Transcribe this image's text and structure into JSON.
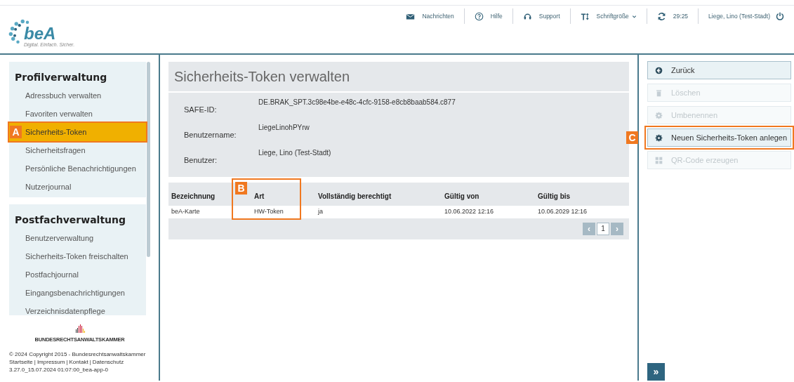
{
  "header": {
    "logo": {
      "name": "beA",
      "tagline": "Digital. Einfach. Sicher."
    },
    "nav": [
      {
        "kind": "mail",
        "label": "Nachrichten"
      },
      {
        "kind": "help",
        "label": "Hilfe"
      },
      {
        "kind": "support",
        "label": "Support"
      },
      {
        "kind": "font",
        "label": "Schriftgröße",
        "dropdown": true
      },
      {
        "kind": "refresh",
        "label": "29:25"
      },
      {
        "kind": "user",
        "label": "Liege, Lino (Test-Stadt)"
      }
    ]
  },
  "sidebar": {
    "sections": [
      {
        "title": "Profilverwaltung",
        "items": [
          {
            "label": "Adressbuch verwalten",
            "selected": false
          },
          {
            "label": "Favoriten verwalten",
            "selected": false
          },
          {
            "label": "Sicherheits-Token",
            "selected": true,
            "callout": "A"
          },
          {
            "label": "Sicherheitsfragen",
            "selected": false
          },
          {
            "label": "Persönliche Benachrichtigungen",
            "selected": false
          },
          {
            "label": "Nutzerjournal",
            "selected": false
          }
        ]
      },
      {
        "title": "Postfachverwaltung",
        "items": [
          {
            "label": "Benutzerverwaltung",
            "selected": false
          },
          {
            "label": "Sicherheits-Token freischalten",
            "selected": false
          },
          {
            "label": "Postfachjournal",
            "selected": false
          },
          {
            "label": "Eingangsbenachrichtigungen",
            "selected": false
          },
          {
            "label": "Verzeichnisdatenpflege",
            "selected": false
          }
        ]
      }
    ],
    "org": "BUNDESRECHTSANWALTSKAMMER",
    "copyright": "© 2024 Copyright 2015 - Bundesrechtsanwaltskammer",
    "links": [
      "Startseite",
      "Impressum",
      "Kontakt",
      "Datenschutz"
    ],
    "link_separator": "|",
    "version": "3.27.0_15.07.2024 01:07:00_bea-app-0"
  },
  "main": {
    "title": "Sicherheits-Token verwalten",
    "fields": [
      {
        "label": "SAFE-ID:",
        "value": "DE.BRAK_SPT.3c98e4be-e48c-4cfc-9158-e8cb8baab584.c877"
      },
      {
        "label": "Benutzername:",
        "value": "LiegeLinohPYrw"
      },
      {
        "label": "Benutzer:",
        "value": "Liege, Lino (Test-Stadt)"
      }
    ],
    "table": {
      "columns": [
        {
          "label": "Bezeichnung"
        },
        {
          "label": "Art",
          "callout": "B"
        },
        {
          "label": "Vollständig berechtigt"
        },
        {
          "label": "Gültig von"
        },
        {
          "label": "Gültig bis"
        }
      ],
      "rows": [
        [
          "beA-Karte",
          "HW-Token",
          "ja",
          "10.06.2022 12:16",
          "10.06.2029 12:16"
        ]
      ]
    },
    "pagination": {
      "prev": "‹",
      "page": "1",
      "next": "›"
    }
  },
  "actions": [
    {
      "kind": "back",
      "label": "Zurück",
      "disabled": false
    },
    {
      "kind": "trash",
      "label": "Löschen",
      "disabled": true
    },
    {
      "kind": "gear",
      "label": "Umbenennen",
      "disabled": true
    },
    {
      "kind": "gear",
      "label": "Neuen Sicherheits-Token anlegen",
      "disabled": false,
      "callout": "C"
    },
    {
      "kind": "qr",
      "label": "QR-Code erzeugen",
      "disabled": true
    }
  ],
  "expand_button": "»"
}
